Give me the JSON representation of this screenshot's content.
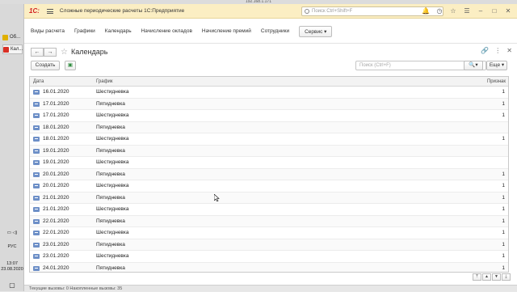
{
  "remote_host": "192.168.1.171",
  "taskbar": {
    "items": [
      {
        "label": "Об..."
      },
      {
        "label": "Кал..."
      }
    ],
    "lang": "РУС",
    "time": "13:07",
    "date": "23.08.2020"
  },
  "titlebar": {
    "logo": "1С:",
    "title": "Сложные периодические расчеты 1С:Предприятие",
    "search_placeholder": "Поиск Ctrl+Shift+F"
  },
  "sections": [
    "Виды расчета",
    "Графики",
    "Календарь",
    "Начисление окладов",
    "Начисление премий",
    "Сотрудники"
  ],
  "service_label": "Сервис",
  "page_title": "Календарь",
  "commands": {
    "create_label": "Создать",
    "search_placeholder": "Поиск (Ctrl+F)",
    "more_label": "Еще"
  },
  "table": {
    "columns": [
      "Дата",
      "График",
      "Признак"
    ],
    "rows": [
      {
        "date": "16.01.2020",
        "schedule": "Шестидневка",
        "flag": "1"
      },
      {
        "date": "17.01.2020",
        "schedule": "Пятидневка",
        "flag": "1"
      },
      {
        "date": "17.01.2020",
        "schedule": "Шестидневка",
        "flag": "1"
      },
      {
        "date": "18.01.2020",
        "schedule": "Пятидневка",
        "flag": ""
      },
      {
        "date": "18.01.2020",
        "schedule": "Шестидневка",
        "flag": "1"
      },
      {
        "date": "19.01.2020",
        "schedule": "Пятидневка",
        "flag": ""
      },
      {
        "date": "19.01.2020",
        "schedule": "Шестидневка",
        "flag": ""
      },
      {
        "date": "20.01.2020",
        "schedule": "Пятидневка",
        "flag": "1"
      },
      {
        "date": "20.01.2020",
        "schedule": "Шестидневка",
        "flag": "1"
      },
      {
        "date": "21.01.2020",
        "schedule": "Пятидневка",
        "flag": "1"
      },
      {
        "date": "21.01.2020",
        "schedule": "Шестидневка",
        "flag": "1"
      },
      {
        "date": "22.01.2020",
        "schedule": "Пятидневка",
        "flag": "1"
      },
      {
        "date": "22.01.2020",
        "schedule": "Шестидневка",
        "flag": "1"
      },
      {
        "date": "23.01.2020",
        "schedule": "Пятидневка",
        "flag": "1"
      },
      {
        "date": "23.01.2020",
        "schedule": "Шестидневка",
        "flag": "1"
      },
      {
        "date": "24.01.2020",
        "schedule": "Пятидневка",
        "flag": "1"
      }
    ]
  },
  "status": "Текущие вызовы: 0   Накопленные вызовы: 35"
}
